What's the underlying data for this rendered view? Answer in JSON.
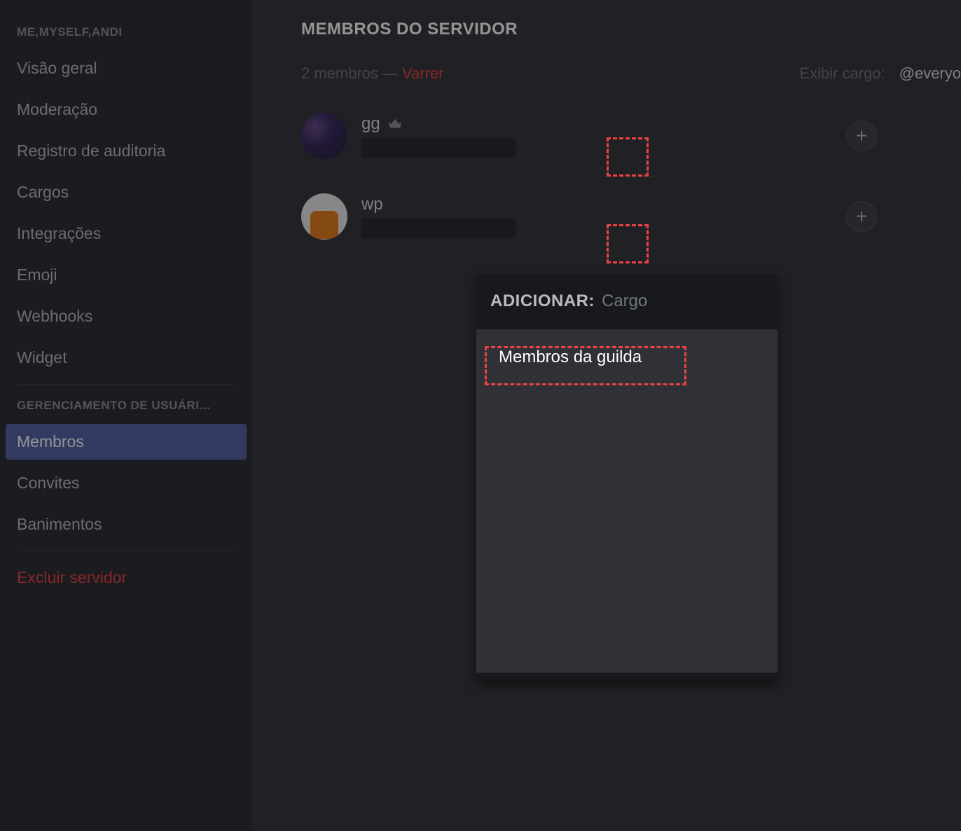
{
  "sidebar": {
    "header1": "ME,MYSELF,ANDI",
    "items1": [
      "Visão geral",
      "Moderação",
      "Registro de auditoria",
      "Cargos",
      "Integrações",
      "Emoji",
      "Webhooks",
      "Widget"
    ],
    "header2": "GERENCIAMENTO DE USUÁRI...",
    "items2": [
      "Membros",
      "Convites",
      "Banimentos"
    ],
    "delete": "Excluir servidor"
  },
  "main": {
    "title": "MEMBROS DO SERVIDOR",
    "members_count": "2 membros",
    "dash": "—",
    "prune": "Varrer",
    "display_role_label": "Exibir cargo:",
    "display_role_value": "@everyo",
    "members": [
      {
        "name": "gg",
        "owner": true
      },
      {
        "name": "wp",
        "owner": false
      }
    ]
  },
  "popover": {
    "label": "ADICIONAR:",
    "placeholder": "Cargo",
    "option": "Membros da guilda"
  }
}
